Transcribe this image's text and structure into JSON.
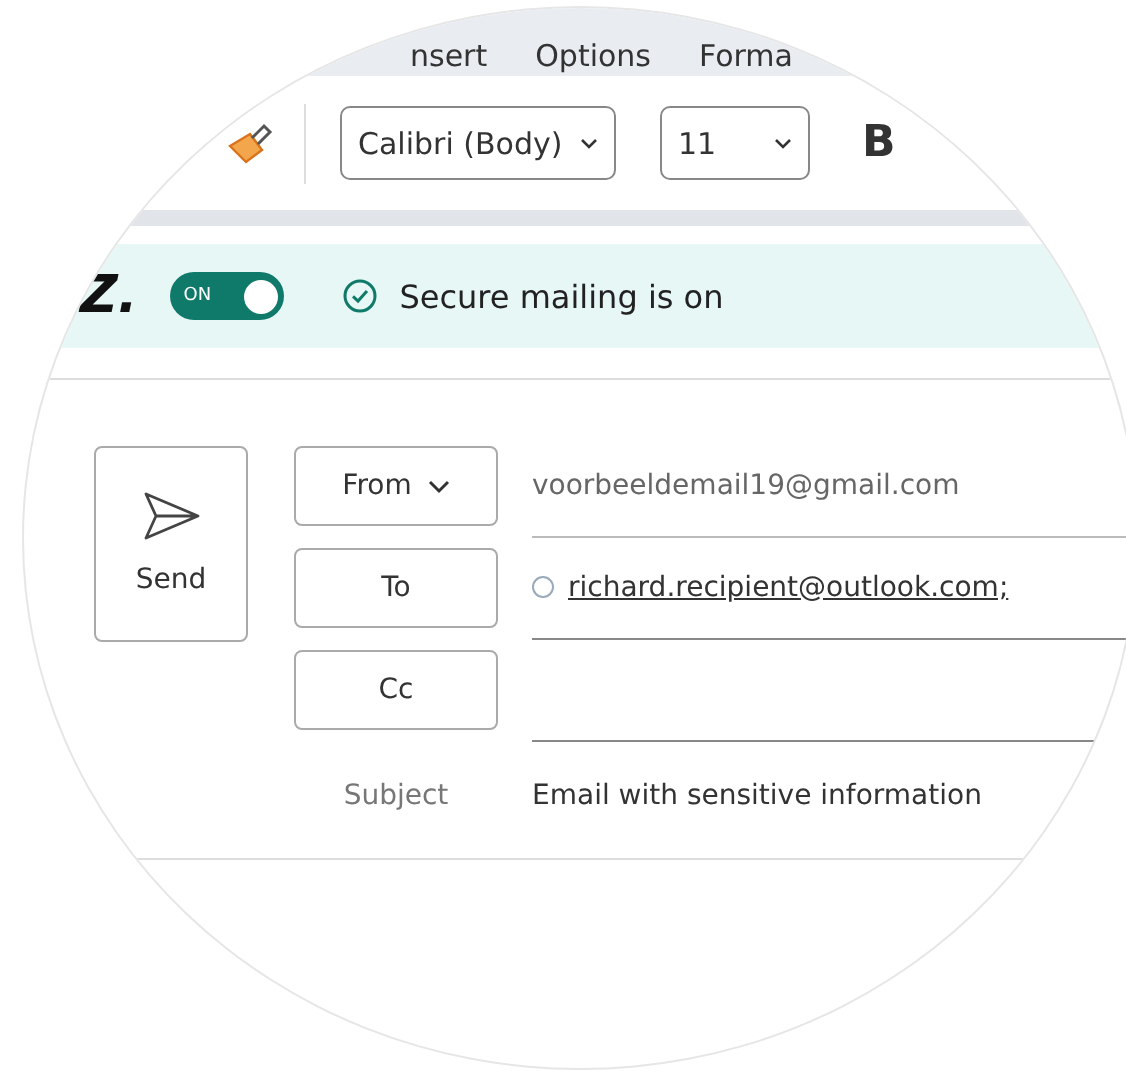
{
  "tabs": [
    {
      "label": "nsert"
    },
    {
      "label": "Options"
    },
    {
      "label": "Forma"
    }
  ],
  "toolbar": {
    "font": "Calibri (Body)",
    "size": "11",
    "bold_label": "B"
  },
  "secure": {
    "logo": "Z.",
    "toggle_label": "ON",
    "on": true,
    "message": "Secure mailing is on"
  },
  "compose": {
    "send": "Send",
    "fields": [
      {
        "label": "From",
        "kind": "dropdown",
        "value": "voorbeeldemail19@gmail.com"
      },
      {
        "label": "To",
        "kind": "recipients",
        "value": "richard.recipient@outlook.com;"
      },
      {
        "label": "Cc",
        "kind": "recipients"
      }
    ],
    "subject": {
      "label": "Subject",
      "value": "Email with sensitive information"
    }
  }
}
